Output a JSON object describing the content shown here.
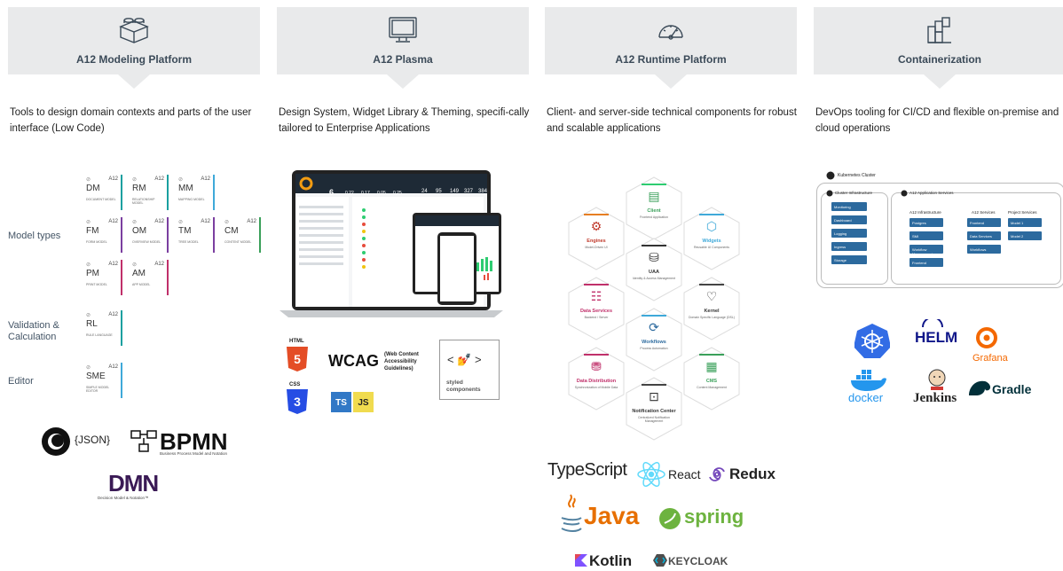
{
  "columns": [
    {
      "title": "A12 Modeling Platform",
      "icon": "lego-brick-icon",
      "description": "Tools to design domain contexts and parts of the user interface (Low Code)"
    },
    {
      "title": "A12 Plasma",
      "icon": "monitor-icon",
      "description": "Design System, Widget Library & Theming, specifi-cally tailored to Enterprise Applications"
    },
    {
      "title": "A12 Runtime Platform",
      "icon": "gauge-icon",
      "description": "Client- and server-side technical components for robust and scalable applications"
    },
    {
      "title": "Containerization",
      "icon": "containers-icon",
      "description": "DevOps tooling for CI/CD and flexible on-premise and cloud operations"
    }
  ],
  "modeling": {
    "labels": {
      "model_types": "Model types",
      "validation": "Validation & Calculation",
      "editor": "Editor"
    },
    "tiles": [
      {
        "code": "DM",
        "sub": "DOCUMENT MODEL",
        "color": "#1aa0a0"
      },
      {
        "code": "RM",
        "sub": "RELATIONSHIP MODEL",
        "color": "#1aa0a0"
      },
      {
        "code": "MM",
        "sub": "MAPPING MODEL",
        "color": "#3fa9d9"
      },
      {
        "code": "FM",
        "sub": "FORM MODEL",
        "color": "#7b3fa0"
      },
      {
        "code": "OM",
        "sub": "OVERVIEW MODEL",
        "color": "#7b3fa0"
      },
      {
        "code": "TM",
        "sub": "TREE MODEL",
        "color": "#7b3fa0"
      },
      {
        "code": "CM",
        "sub": "CONTENT MODEL",
        "color": "#3aa05a"
      },
      {
        "code": "PM",
        "sub": "PRINT MODEL",
        "color": "#c0306a"
      },
      {
        "code": "AM",
        "sub": "APP MODEL",
        "color": "#c0306a"
      },
      {
        "code": "RL",
        "sub": "RULE LANGUAGE",
        "color": "#1aa0a0"
      },
      {
        "code": "SME",
        "sub": "SIMPLE MODEL EDITOR",
        "color": "#3fa9d9"
      }
    ],
    "a12": "A12",
    "logos": {
      "json": "{JSON}",
      "bpmn": "BPMN",
      "bpmn_sub": "Business Process Model and Notation",
      "dmn": "DMN",
      "dmn_sub": "Decision Model & Notation™"
    }
  },
  "plasma": {
    "dashboard_values": [
      "6",
      "0.22",
      "0.17",
      "0.05",
      "0.25",
      "24",
      "95",
      "149",
      "327",
      "384"
    ],
    "tags": {
      "html": "HTML",
      "css": "CSS",
      "wcag": "WCAG",
      "wcag_sub": "(Web Content Accessibility Guidelines)",
      "styled": "styled components",
      "ts": "TS",
      "js": "JS",
      "code_glyph": "< 💅 >"
    }
  },
  "runtime": {
    "hexes": [
      {
        "title": "Client",
        "sub": "Frontend Application"
      },
      {
        "title": "Engines",
        "sub": "Model-Driven UI"
      },
      {
        "title": "Widgets",
        "sub": "Reusable UI Components"
      },
      {
        "title": "UAA",
        "sub": "Identity & Access Management"
      },
      {
        "title": "Data Services",
        "sub": "Backend / Server"
      },
      {
        "title": "Kernel",
        "sub": "Domain Specific Language (DSL)"
      },
      {
        "title": "Workflows",
        "sub": "Process Automation"
      },
      {
        "title": "Data Distribution",
        "sub": "Synchronization of Mobile Data"
      },
      {
        "title": "CMS",
        "sub": "Content Management"
      },
      {
        "title": "Notification Center",
        "sub": "Centralized Notification Management"
      }
    ],
    "logos": {
      "typescript": "TypeScript",
      "react": "React",
      "redux": "Redux",
      "java": "Java",
      "spring": "spring",
      "kotlin": "Kotlin",
      "keycloak": "KEYCLOAK"
    }
  },
  "container": {
    "cluster": "Kubernetes Cluster",
    "infra": "Cluster Infrastructure",
    "app_services": "A12 Application Services",
    "infra_items": [
      "Monitoring",
      "Dashboard",
      "Logging",
      "Ingress",
      "Storage"
    ],
    "a12_infra": "A12 Infrastructure",
    "a12_infra_items": [
      "Postgres",
      "SMI",
      "Workflow Management",
      "Frontend"
    ],
    "a12_services": "A12 Services",
    "a12_services_items": [
      "Frontend",
      "Data Services",
      "Workflows"
    ],
    "project_services": "Project Services",
    "project_items": [
      "Model 1",
      "Model 2"
    ],
    "logos": {
      "helm": "HELM",
      "grafana": "Grafana",
      "docker": "docker",
      "jenkins": "Jenkins",
      "gradle": "Gradle"
    }
  }
}
